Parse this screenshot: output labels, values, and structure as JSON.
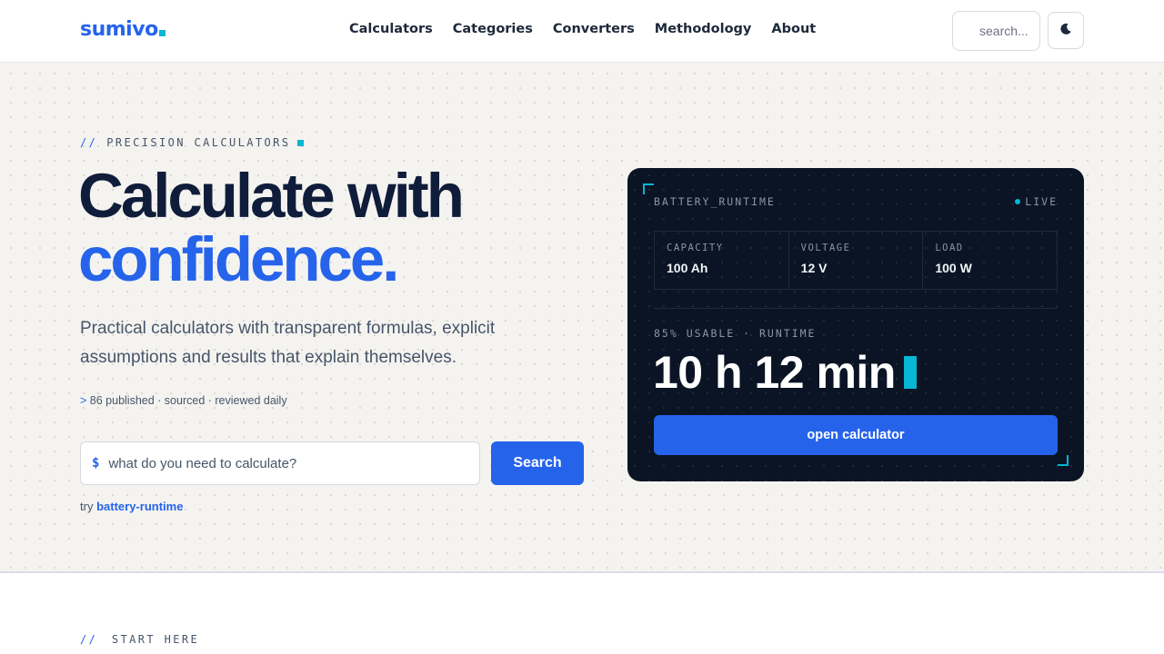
{
  "header": {
    "logo": "sumivo",
    "nav": [
      "Calculators",
      "Categories",
      "Converters",
      "Methodology",
      "About"
    ],
    "search_placeholder": "search...",
    "theme_icon": "moon-icon"
  },
  "hero": {
    "eyebrow_prefix": "//",
    "eyebrow": "PRECISION CALCULATORS",
    "headline_line1": "Calculate with",
    "headline_line2": "confidence.",
    "lead": "Practical calculators with transparent formulas, explicit assumptions and results that explain themselves.",
    "meta_prefix": ">",
    "meta": "86 published · sourced · reviewed daily",
    "search_prompt": "$",
    "search_placeholder": "what do you need to calculate?",
    "search_button": "Search",
    "try_label": "try",
    "try_link": "battery-runtime"
  },
  "card": {
    "title": "BATTERY_RUNTIME",
    "status": "LIVE",
    "params": [
      {
        "label": "CAPACITY",
        "value": "100 Ah"
      },
      {
        "label": "VOLTAGE",
        "value": "12 V"
      },
      {
        "label": "LOAD",
        "value": "100 W"
      }
    ],
    "result_label": "85% USABLE · RUNTIME",
    "result": "10 h 12 min",
    "button": "open calculator"
  },
  "next_section": {
    "prefix": "//",
    "title": "START HERE"
  },
  "colors": {
    "accent": "#2563eb",
    "highlight": "#06b6d4",
    "card_bg": "#0b1424"
  }
}
